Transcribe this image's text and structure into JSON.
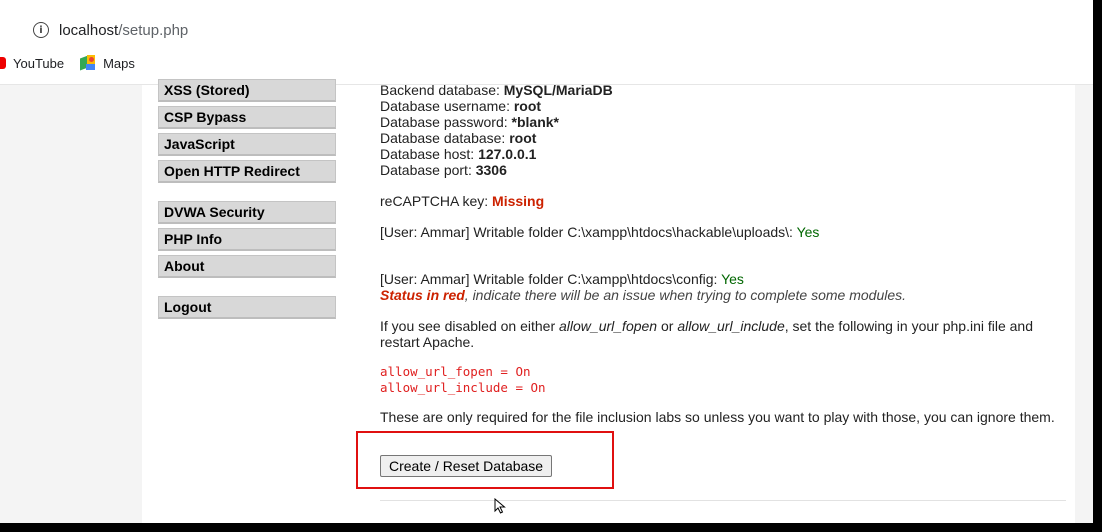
{
  "browser": {
    "url_host": "localhost",
    "url_path": "/setup.php",
    "bookmarks": [
      {
        "label": "YouTube",
        "icon": "youtube-icon"
      },
      {
        "label": "Maps",
        "icon": "maps-icon"
      }
    ]
  },
  "menu": {
    "group1": [
      "XSS (Stored)",
      "CSP Bypass",
      "JavaScript",
      "Open HTTP Redirect"
    ],
    "group2": [
      "DVWA Security",
      "PHP Info",
      "About"
    ],
    "group3": [
      "Logout"
    ]
  },
  "db": {
    "backend_label": "Backend database:",
    "backend_value": "MySQL/MariaDB",
    "username_label": "Database username:",
    "username_value": "root",
    "password_label": "Database password:",
    "password_value": "*blank*",
    "database_label": "Database database:",
    "database_value": "root",
    "host_label": "Database host:",
    "host_value": "127.0.0.1",
    "port_label": "Database port:",
    "port_value": "3306"
  },
  "recaptcha": {
    "label": "reCAPTCHA key:",
    "value": "Missing"
  },
  "uploads": {
    "text": "[User: Ammar] Writable folder C:\\xampp\\htdocs\\hackable\\uploads\\:",
    "value": "Yes"
  },
  "config": {
    "text": "[User: Ammar] Writable folder C:\\xampp\\htdocs\\config:",
    "value": "Yes"
  },
  "status_note": {
    "red": "Status in red",
    "rest": ", indicate there will be an issue when trying to complete some modules."
  },
  "disabled_note": {
    "part1": "If you see disabled on either ",
    "fopen": "allow_url_fopen",
    "or": " or ",
    "include": "allow_url_include",
    "part2": ", set the following in your php.ini file and restart Apache."
  },
  "code": [
    "allow_url_fopen = On",
    "allow_url_include = On"
  ],
  "labs_note": "These are only required for the file inclusion labs so unless you want to play with those, you can ignore them.",
  "button_label": "Create / Reset Database",
  "colors": {
    "highlight": "#e01010",
    "error": "#cc2200",
    "ok": "#006600"
  }
}
